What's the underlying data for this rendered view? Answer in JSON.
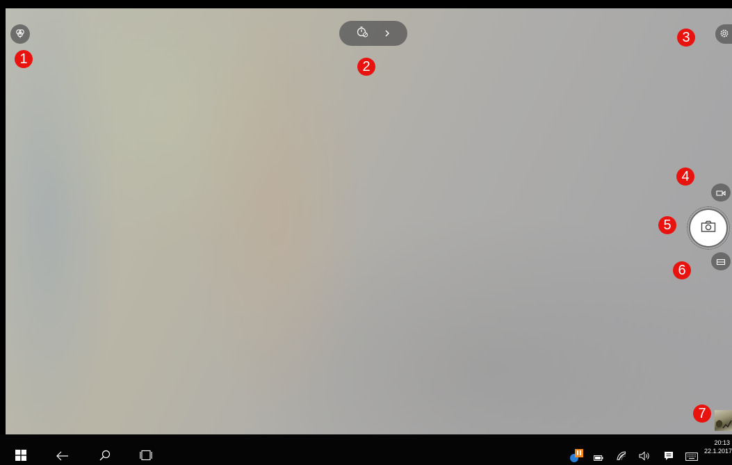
{
  "camera": {
    "left_button_icon": "hdr-icon",
    "timer_icon": "timer-off-icon",
    "timer_expand_icon": "chevron-right-icon",
    "settings_icon": "gear-icon",
    "video_mode_icon": "video-camera-icon",
    "shutter_icon": "camera-icon",
    "photo_mode_icon": "panorama-icon",
    "gallery_thumbnail_icon": "photo-thumbnail"
  },
  "annotations": [
    "1",
    "2",
    "3",
    "4",
    "5",
    "6",
    "7"
  ],
  "taskbar": {
    "start_icon": "windows-logo-icon",
    "back_icon": "back-arrow-icon",
    "search_icon": "search-icon",
    "task_view_icon": "task-view-icon",
    "tray_icons": [
      "warning-badge-icon",
      "battery-icon",
      "wifi-icon",
      "volume-icon",
      "action-center-icon",
      "keyboard-icon"
    ],
    "time": "20:13",
    "date": "22.1.2017"
  },
  "colors": {
    "badge": "#e8130f",
    "button_bg": "#5f5f5f",
    "taskbar": "#050505"
  }
}
